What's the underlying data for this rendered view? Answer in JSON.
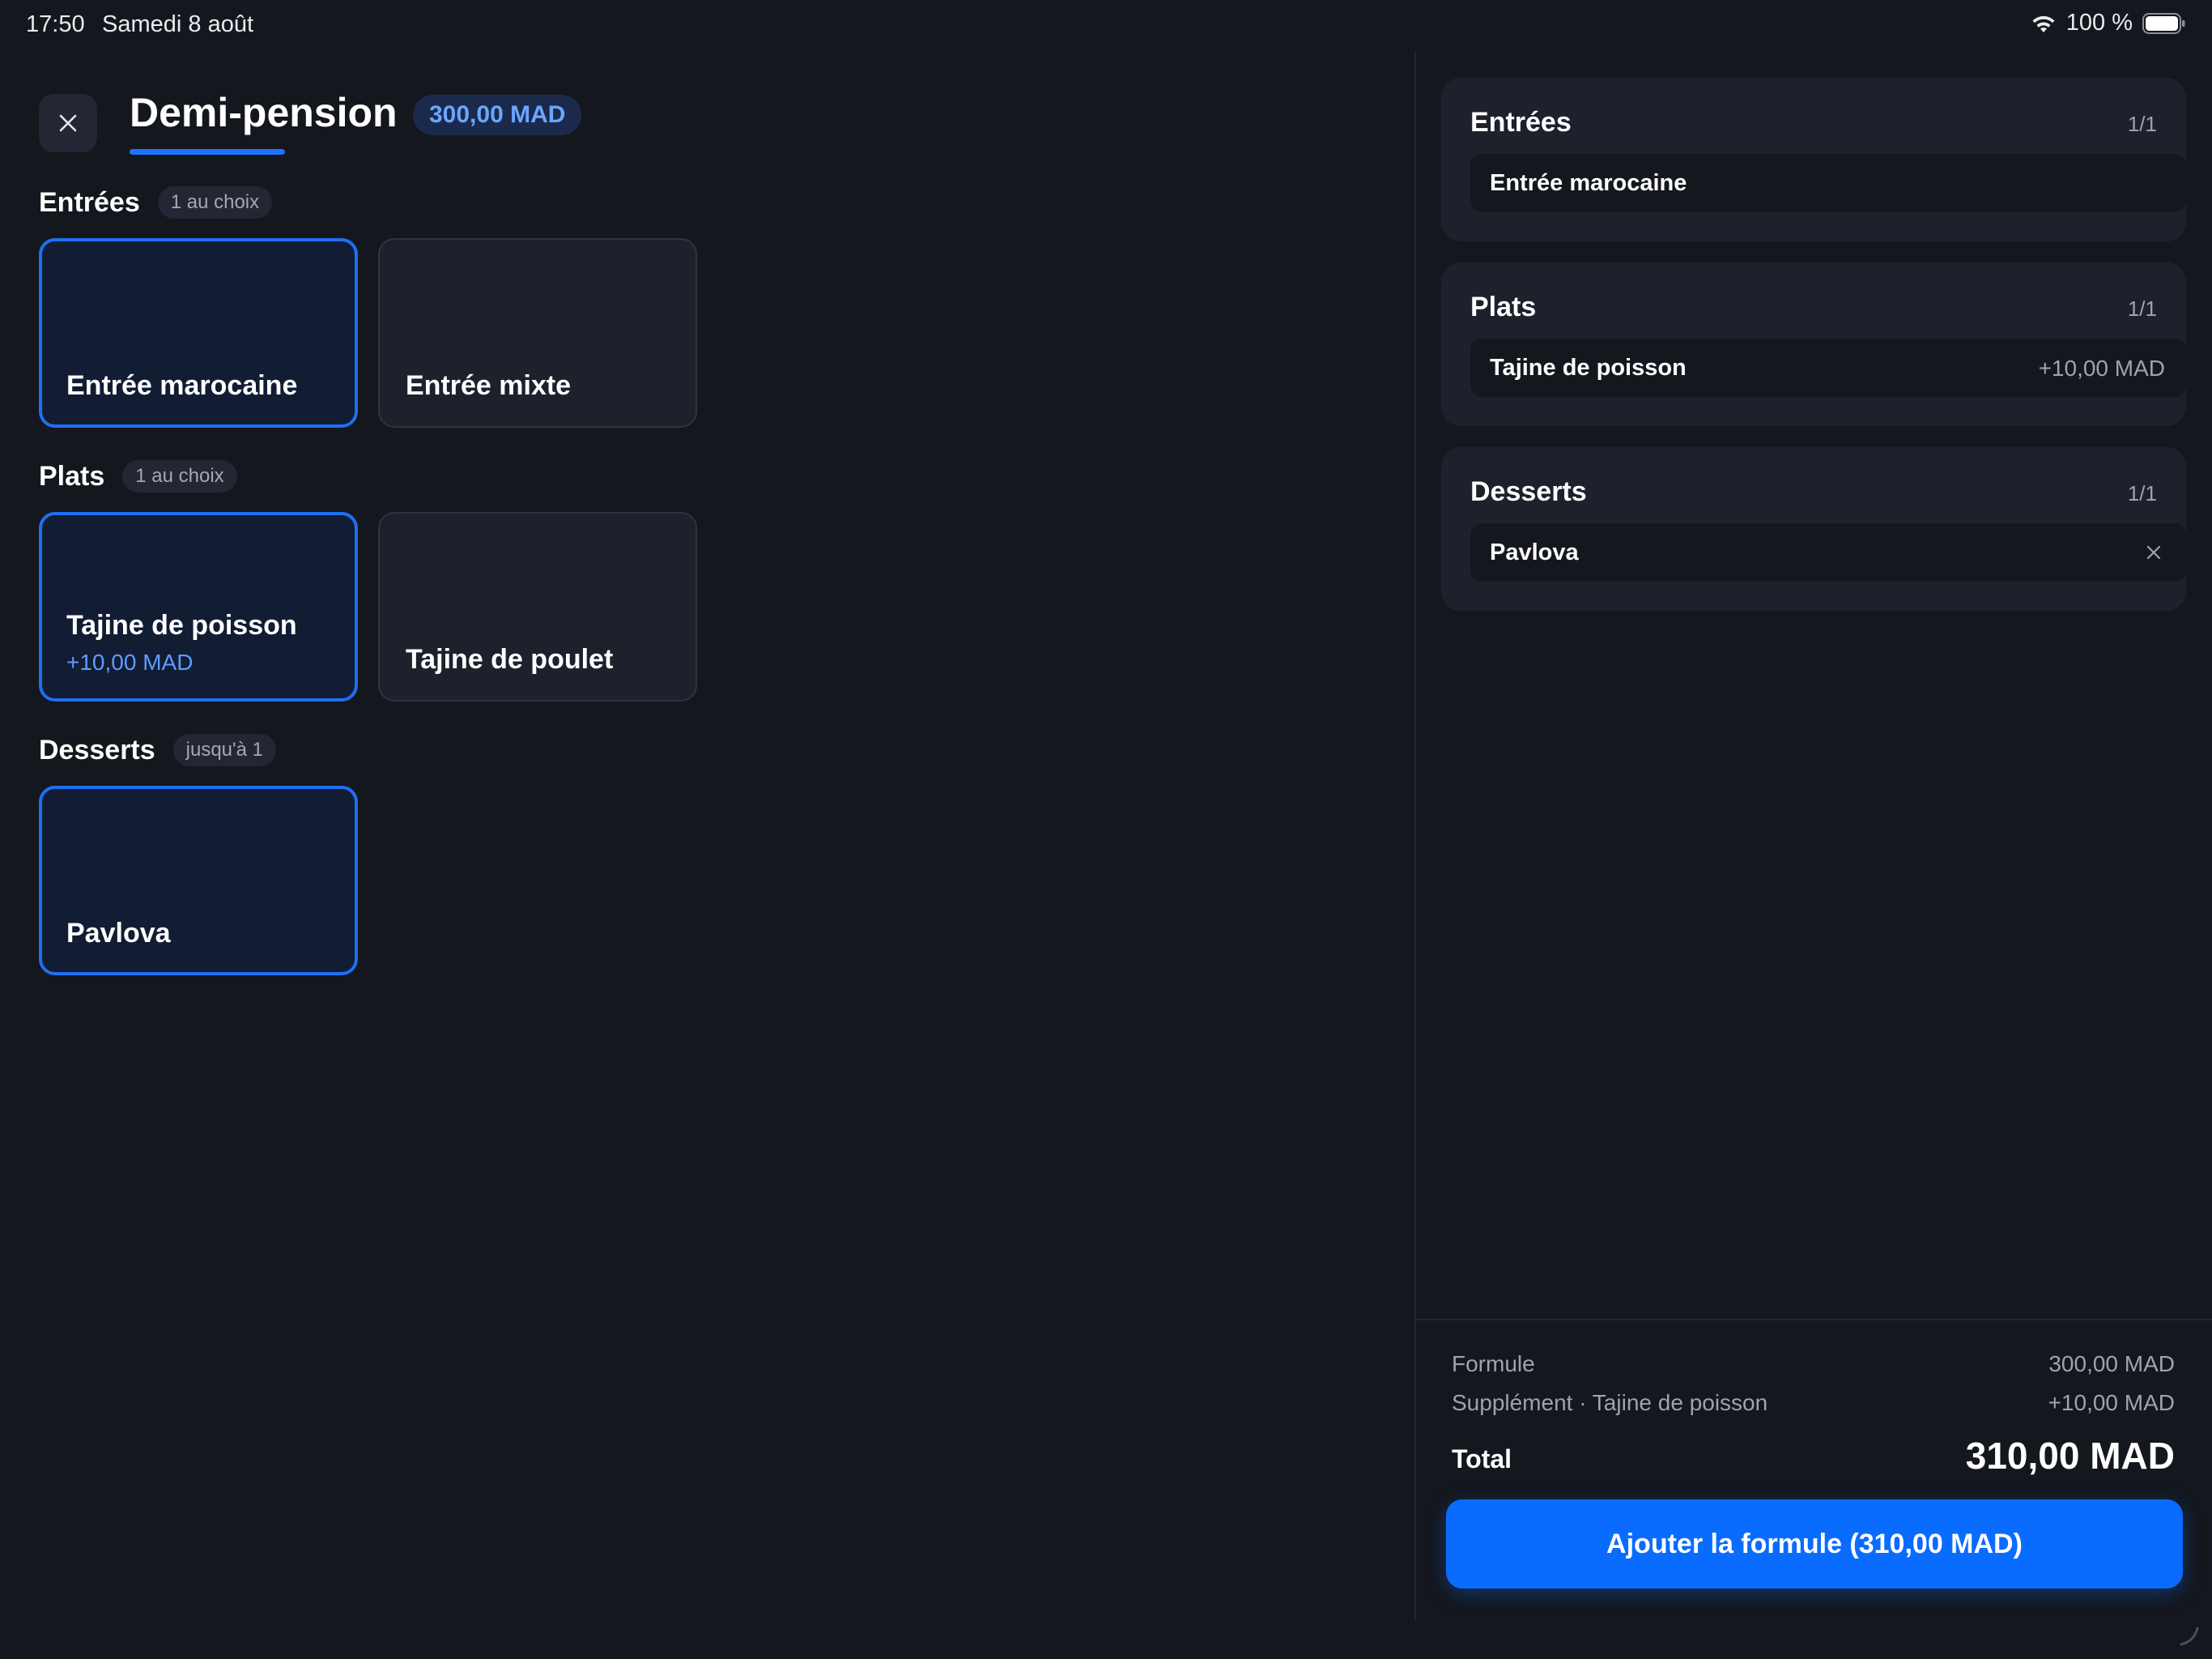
{
  "status_bar": {
    "time": "17:50",
    "date": "Samedi 8 août",
    "battery": "100 %"
  },
  "header": {
    "title": "Demi-pension",
    "price": "300,00 MAD"
  },
  "colors": {
    "accent": "#0a6cff",
    "background": "#14171d",
    "card": "#1e212b",
    "selected_card": "#121c33"
  },
  "sections": [
    {
      "title": "Entrées",
      "rule": "1 au choix",
      "options": [
        {
          "name": "Entrée marocaine",
          "extra": "",
          "selected": true
        },
        {
          "name": "Entrée mixte",
          "extra": "",
          "selected": false
        }
      ]
    },
    {
      "title": "Plats",
      "rule": "1 au choix",
      "options": [
        {
          "name": "Tajine de poisson",
          "extra": "+10,00 MAD",
          "selected": true
        },
        {
          "name": "Tajine de poulet",
          "extra": "",
          "selected": false
        }
      ]
    },
    {
      "title": "Desserts",
      "rule": "jusqu'à 1",
      "options": [
        {
          "name": "Pavlova",
          "extra": "",
          "selected": true
        }
      ]
    }
  ],
  "selection": [
    {
      "title": "Entrées",
      "count": "1/1",
      "item": "Entrée marocaine",
      "extra": ""
    },
    {
      "title": "Plats",
      "count": "1/1",
      "item": "Tajine de poisson",
      "extra": "+10,00 MAD"
    },
    {
      "title": "Desserts",
      "count": "1/1",
      "item": "Pavlova",
      "extra": ""
    }
  ],
  "summary": {
    "formula_label": "Formule",
    "formula_value": "300,00 MAD",
    "supplement_label": "Supplément · Tajine de poisson",
    "supplement_value": "+10,00 MAD",
    "total_label": "Total",
    "total_value": "310,00 MAD"
  },
  "add_button": "Ajouter la formule (310,00 MAD)"
}
